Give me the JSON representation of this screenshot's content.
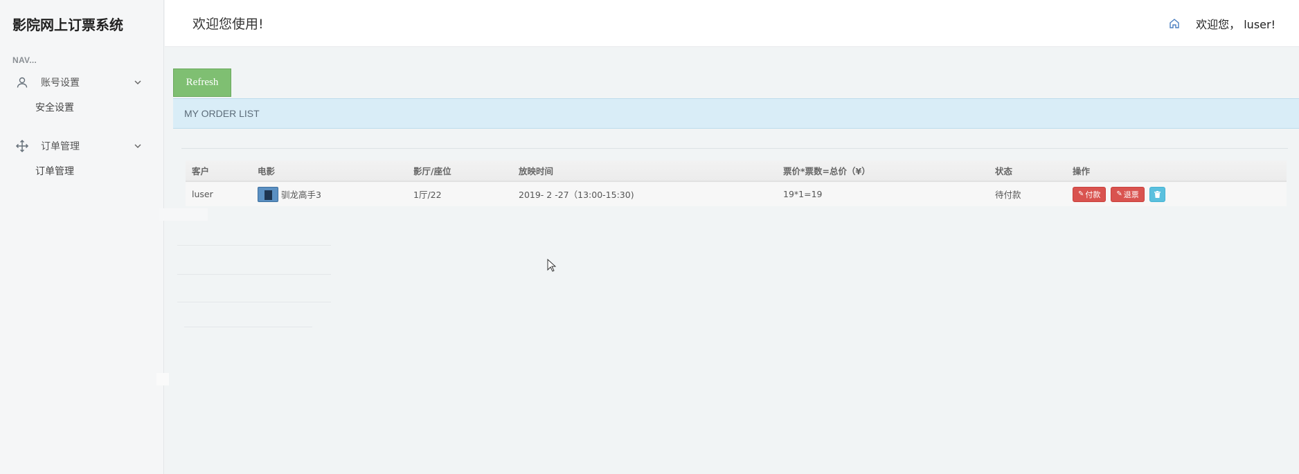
{
  "brand": {
    "title": "影院网上订票系统"
  },
  "nav": {
    "heading": "NAV...",
    "groups": [
      {
        "label": "账号设置",
        "icon": "user-icon",
        "children": [
          {
            "label": "安全设置"
          }
        ]
      },
      {
        "label": "订单管理",
        "icon": "move-arrows-icon",
        "children": [
          {
            "label": "订单管理"
          }
        ]
      }
    ]
  },
  "header": {
    "welcome": "欢迎您使用!",
    "home_icon": "home-icon",
    "user_welcome": "欢迎您， luser!"
  },
  "main": {
    "refresh_label": "Refresh",
    "panel_title": "MY ORDER LIST",
    "table": {
      "columns": [
        "客户",
        "电影",
        "影厅/座位",
        "放映时间",
        "票价*票数=总价（¥）",
        "状态",
        "操作"
      ],
      "rows": [
        {
          "customer": "luser",
          "movie": "驯龙高手3",
          "hall_seat": "1厅/22",
          "showtime": "2019- 2 -27（13:00-15:30)",
          "price_total": "19*1=19",
          "status": "待付款",
          "actions": {
            "pay": "付款",
            "refund": "退票"
          }
        }
      ]
    }
  },
  "colors": {
    "refresh_button": "#7fbf72",
    "panel_header": "#d9edf7",
    "danger_button": "#d9534f",
    "info_button": "#5bc0de",
    "home_icon": "#4a7fc0"
  }
}
